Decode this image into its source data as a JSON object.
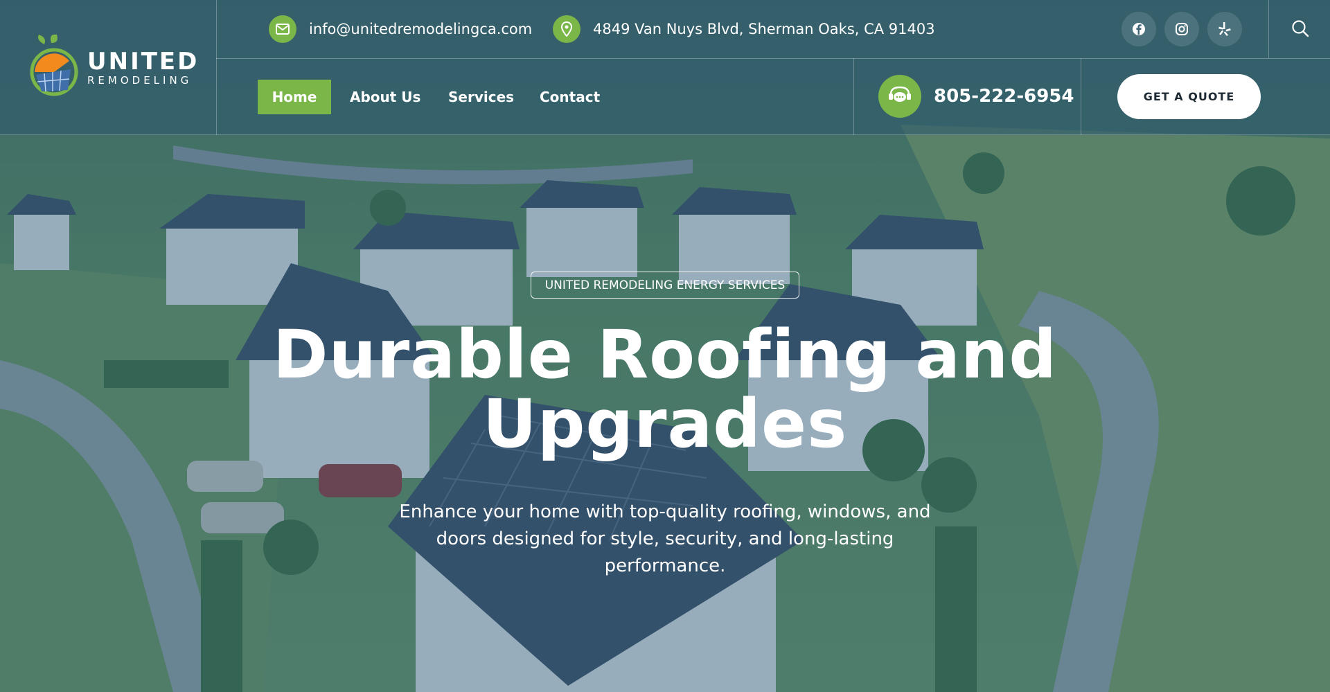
{
  "brand": {
    "name_line1": "UNITED",
    "name_line2": "REMODELING",
    "accent": "#7ab648",
    "overlay": "#2c5670"
  },
  "topbar": {
    "email": "info@unitedremodelingca.com",
    "email_icon": "mail-icon",
    "address": "4849 Van Nuys Blvd, Sherman Oaks, CA 91403",
    "address_icon": "location-pin-icon",
    "social": [
      "facebook-icon",
      "instagram-icon",
      "yelp-icon"
    ],
    "search_icon": "search-icon"
  },
  "nav": {
    "items": [
      {
        "label": "Home",
        "active": true
      },
      {
        "label": "About Us",
        "active": false
      },
      {
        "label": "Services",
        "active": false
      },
      {
        "label": "Contact",
        "active": false
      }
    ],
    "phone": "805-222-6954",
    "phone_icon": "support-chat-icon",
    "cta_label": "GET A QUOTE"
  },
  "hero": {
    "badge": "UNITED REMODELING ENERGY SERVICES",
    "headline_line1": "Durable Roofing and",
    "headline_line2": "Upgrades",
    "subtext": "Enhance your home with top-quality roofing, windows, and doors designed for style, security, and long-lasting performance."
  }
}
